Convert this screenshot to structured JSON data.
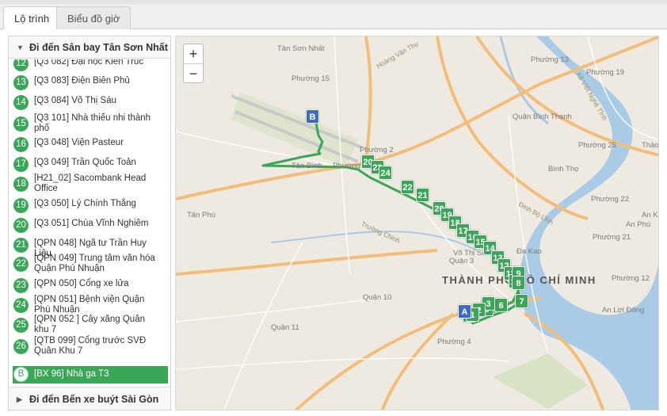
{
  "tabs": [
    {
      "label": "Lộ trình"
    },
    {
      "label": "Biểu đồ giờ"
    }
  ],
  "sidebar": {
    "route_to": "Đi đến Sân bay Tân Sơn Nhất",
    "route_back": "Đi đến Bến xe buýt Sài Gòn",
    "stops": [
      {
        "num": "12",
        "name": "[Q3 082] Đại học Kiến Trúc"
      },
      {
        "num": "13",
        "name": "[Q3 083] Điện Biên Phủ"
      },
      {
        "num": "14",
        "name": "[Q3 084] Võ Thị Sáu"
      },
      {
        "num": "15",
        "name": "[Q3 101] Nhà thiếu nhi thành phố"
      },
      {
        "num": "16",
        "name": "[Q3 048] Viện Pasteur"
      },
      {
        "num": "17",
        "name": "[Q3 049] Trần Quốc Toản"
      },
      {
        "num": "18",
        "name": "[H21_02] Sacombank Head Office"
      },
      {
        "num": "19",
        "name": "[Q3 050] Lý Chính Thắng"
      },
      {
        "num": "20",
        "name": "[Q3 051] Chùa Vĩnh Nghiêm"
      },
      {
        "num": "21",
        "name": "[QPN 048] Ngã tư Trần Huy Liệu"
      },
      {
        "num": "22",
        "name": "[QPN 049] Trung tâm văn hóa Quận Phú Nhuận"
      },
      {
        "num": "23",
        "name": "[QPN 050] Cổng xe lửa"
      },
      {
        "num": "24",
        "name": "[QPN 051] Bệnh viện Quận Phú Nhuận"
      },
      {
        "num": "25",
        "name": "[QPN 052 ] Cây xăng Quân khu 7"
      },
      {
        "num": "26",
        "name": "[QTB 099] Cổng trước SVĐ Quân Khu 7"
      },
      {
        "num": "B",
        "name": "[BX 96] Nhà ga T3"
      }
    ]
  },
  "map": {
    "zoom_in": "+",
    "zoom_out": "−",
    "city_label": "THÀNH PHỐ HỒ CHÍ MINH",
    "labels": [
      "Tân Sơn Nhất",
      "Phường 15",
      "Phường 2",
      "Tân Bình",
      "Tân Phú",
      "Quận 10",
      "Quận 11",
      "Quận 3",
      "Võ Thị Sáu",
      "Đa Kao",
      "Phường 13",
      "Phường 19",
      "Quận Bình Thạnh",
      "Phường 25",
      "Phường 22",
      "Phường 21",
      "Phường 4",
      "Phường 12",
      "Phường 4",
      "Bình Thọ",
      "An Phú",
      "An Lợi Đông",
      "Thảo",
      "An Khánh",
      "Hoàng Văn Thụ",
      "Trường Chinh",
      "Xô Viết Nghệ Tĩnh",
      "Đinh Bộ Lĩnh"
    ],
    "markers": [
      "B",
      "20",
      "23",
      "24",
      "22",
      "21",
      "20",
      "19",
      "18",
      "17",
      "16",
      "15",
      "14",
      "13",
      "12",
      "11",
      "10",
      "9",
      "8",
      "7",
      "6",
      "5",
      "4",
      "3",
      "2",
      "1",
      "A"
    ]
  },
  "colors": {
    "accent": "#3aa757",
    "marker_b": "#3d69c9",
    "map_bg": "#eeeae1",
    "water": "#a9cbe6",
    "major_road": "#f3bd7a"
  }
}
